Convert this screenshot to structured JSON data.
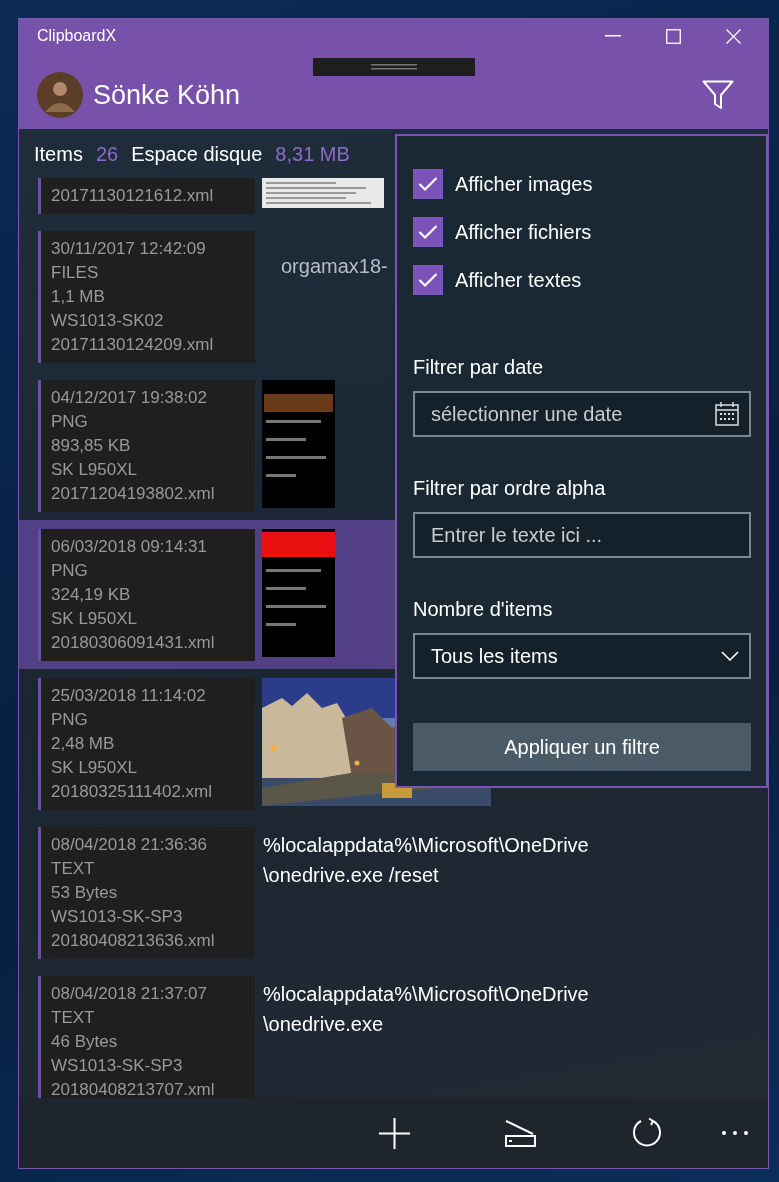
{
  "window": {
    "title": "ClipboardX"
  },
  "header": {
    "user_name": "Sönke Köhn"
  },
  "stats": {
    "items_label": "Items",
    "items_count": "26",
    "disk_label": "Espace disque",
    "disk_size": "8,31 MB"
  },
  "items": [
    {
      "lines": [
        "20171130121612.xml"
      ],
      "selected": false
    },
    {
      "lines": [
        "30/11/2017 12:42:09",
        "FILES",
        "1,1 MB",
        "WS1013-SK02",
        "20171130124209.xml"
      ],
      "preview": {
        "kind": "file",
        "text": "orgamax18-"
      },
      "selected": false
    },
    {
      "lines": [
        "04/12/2017 19:38:02",
        "PNG",
        "893,85 KB",
        "SK L950XL",
        "20171204193802.xml"
      ],
      "selected": false
    },
    {
      "lines": [
        "06/03/2018 09:14:31",
        "PNG",
        "324,19 KB",
        "SK L950XL",
        "20180306091431.xml"
      ],
      "selected": true
    },
    {
      "lines": [
        "25/03/2018 11:14:02",
        "PNG",
        "2,48 MB",
        "SK L950XL",
        "20180325111402.xml"
      ],
      "selected": false
    },
    {
      "lines": [
        "08/04/2018 21:36:36",
        "TEXT",
        "53 Bytes",
        "WS1013-SK-SP3",
        "20180408213636.xml"
      ],
      "preview": {
        "kind": "text",
        "text": "%localappdata%\\Microsoft\\OneDrive\n\\onedrive.exe /reset"
      },
      "selected": false
    },
    {
      "lines": [
        "08/04/2018 21:37:07",
        "TEXT",
        "46 Bytes",
        "WS1013-SK-SP3",
        "20180408213707.xml"
      ],
      "preview": {
        "kind": "text",
        "text": "%localappdata%\\Microsoft\\OneDrive\n\\onedrive.exe"
      },
      "selected": false
    }
  ],
  "filter_panel": {
    "checkboxes": [
      {
        "label": "Afficher images",
        "checked": true
      },
      {
        "label": "Afficher fichiers",
        "checked": true
      },
      {
        "label": "Afficher textes",
        "checked": true
      }
    ],
    "date_filter": {
      "label": "Filtrer par date",
      "placeholder": "sélectionner une date"
    },
    "alpha_filter": {
      "label": "Filtrer par ordre alpha",
      "placeholder": "Entrer le texte ici ..."
    },
    "count_filter": {
      "label": "Nombre d'items",
      "value": "Tous les items"
    },
    "apply_button": "Appliquer un filtre"
  }
}
